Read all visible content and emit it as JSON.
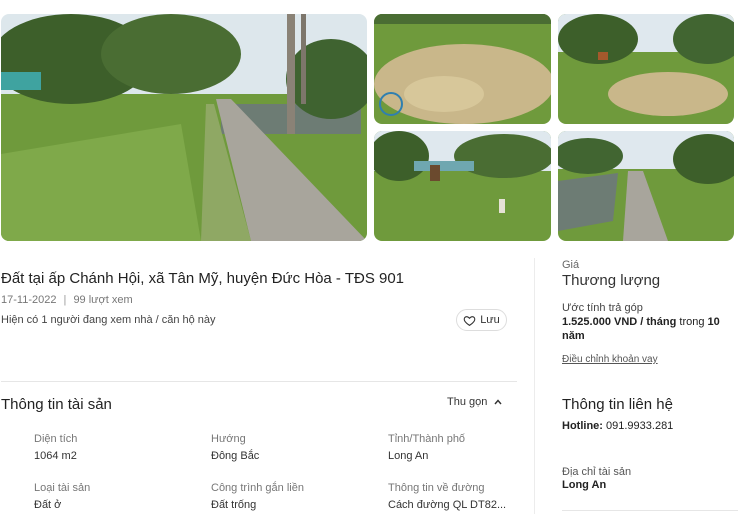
{
  "listing": {
    "title": "Đất tại ấp Chánh Hội, xã Tân Mỹ, huyện Đức Hòa - TĐS 901",
    "date": "17-11-2022",
    "views": "99 lượt xem",
    "viewing_now": "Hiện có 1 người đang xem nhà / căn hộ này",
    "save_label": "Lưu"
  },
  "property_info": {
    "title": "Thông tin tài sản",
    "collapse_label": "Thu gọn",
    "attributes": [
      {
        "label": "Diện tích",
        "value": "1064 m2"
      },
      {
        "label": "Hướng",
        "value": "Đông Bắc"
      },
      {
        "label": "Tỉnh/Thành phố",
        "value": "Long An"
      },
      {
        "label": "Loại tài sản",
        "value": "Đất ở"
      },
      {
        "label": "Công trình gắn liền",
        "value": "Đất trống"
      },
      {
        "label": "Thông tin về đường",
        "value": "Cách đường QL DT82..."
      }
    ]
  },
  "sidebar": {
    "price_label": "Giá",
    "price_value": "Thương lượng",
    "installment_label": "Ước tính trả góp",
    "installment_amount": "1.525.000 VND / tháng",
    "installment_term_prefix": "trong",
    "installment_term_value": "10",
    "installment_term_unit": "năm",
    "adjust_loan_link": "Điều chỉnh khoản vay",
    "contact_title": "Thông tin liên hệ",
    "hotline_label": "Hotline:",
    "hotline_value": "091.9933.281",
    "address_label": "Địa chỉ tài sản",
    "address_value": "Long An"
  },
  "icons": {
    "save": "heart-outline-icon",
    "collapse": "chevron-up-icon"
  },
  "colors": {
    "grass": "#6f9a3c",
    "sky": "#dfe8ee",
    "road": "#a8a59c",
    "water": "#6d7c74",
    "tree": "#3d5f2a",
    "dry_soil": "#c9b78a"
  }
}
